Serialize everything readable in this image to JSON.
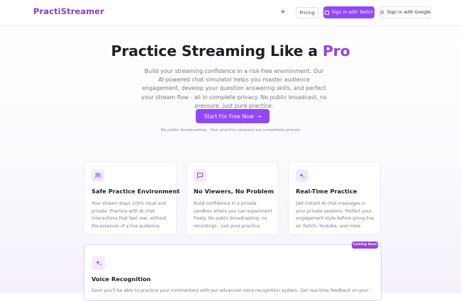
{
  "header": {
    "logo": "PractiStreamer",
    "pricing_label": "Pricing",
    "twitch_label": "Sign in with Twitch",
    "google_label": "Sign in with Google",
    "google_glyph": "G"
  },
  "hero": {
    "title_main": "Practice Streaming Like a ",
    "title_accent": "Pro",
    "description": "Build your streaming confidence in a risk-free environment. Our AI-powered chat simulator helps you master audience engagement, develop your question answering skills, and perfect your stream flow - all in complete privacy. No public broadcast, no pressure, just pure practice.",
    "cta_label": "Start For Free Now",
    "cta_arrow": "→",
    "note": "No public broadcasting - Your practice sessions are completely private"
  },
  "features": [
    {
      "icon": "users-icon",
      "title": "Safe Practice Environment",
      "description": "Your stream stays 100% local and private. Practice with AI chat interactions that feel real, without the pressure of a live audience."
    },
    {
      "icon": "chat-bubble-icon",
      "title": "No Viewers, No Problem",
      "description": "Build confidence in a private sandbox where you can experiment freely. No public broadcasting, no recordings - just pure practice."
    },
    {
      "icon": "sparkles-icon",
      "title": "Real-Time Practice",
      "description": "Get instant AI chat messages in your private sessions. Perfect your engagement style before going live on Twitch, Youtube, and more."
    }
  ],
  "voice": {
    "badge": "Coming Soon",
    "icon": "sparkles-icon",
    "title": "Voice Recognition",
    "description": "Soon you'll be able to practice your commentary with our advanced voice recognition system. Get real-time feedback on your"
  },
  "colors": {
    "accent": "#9146ff",
    "brand_text": "#8a3fd1",
    "pro_text": "#9b3fe2"
  }
}
